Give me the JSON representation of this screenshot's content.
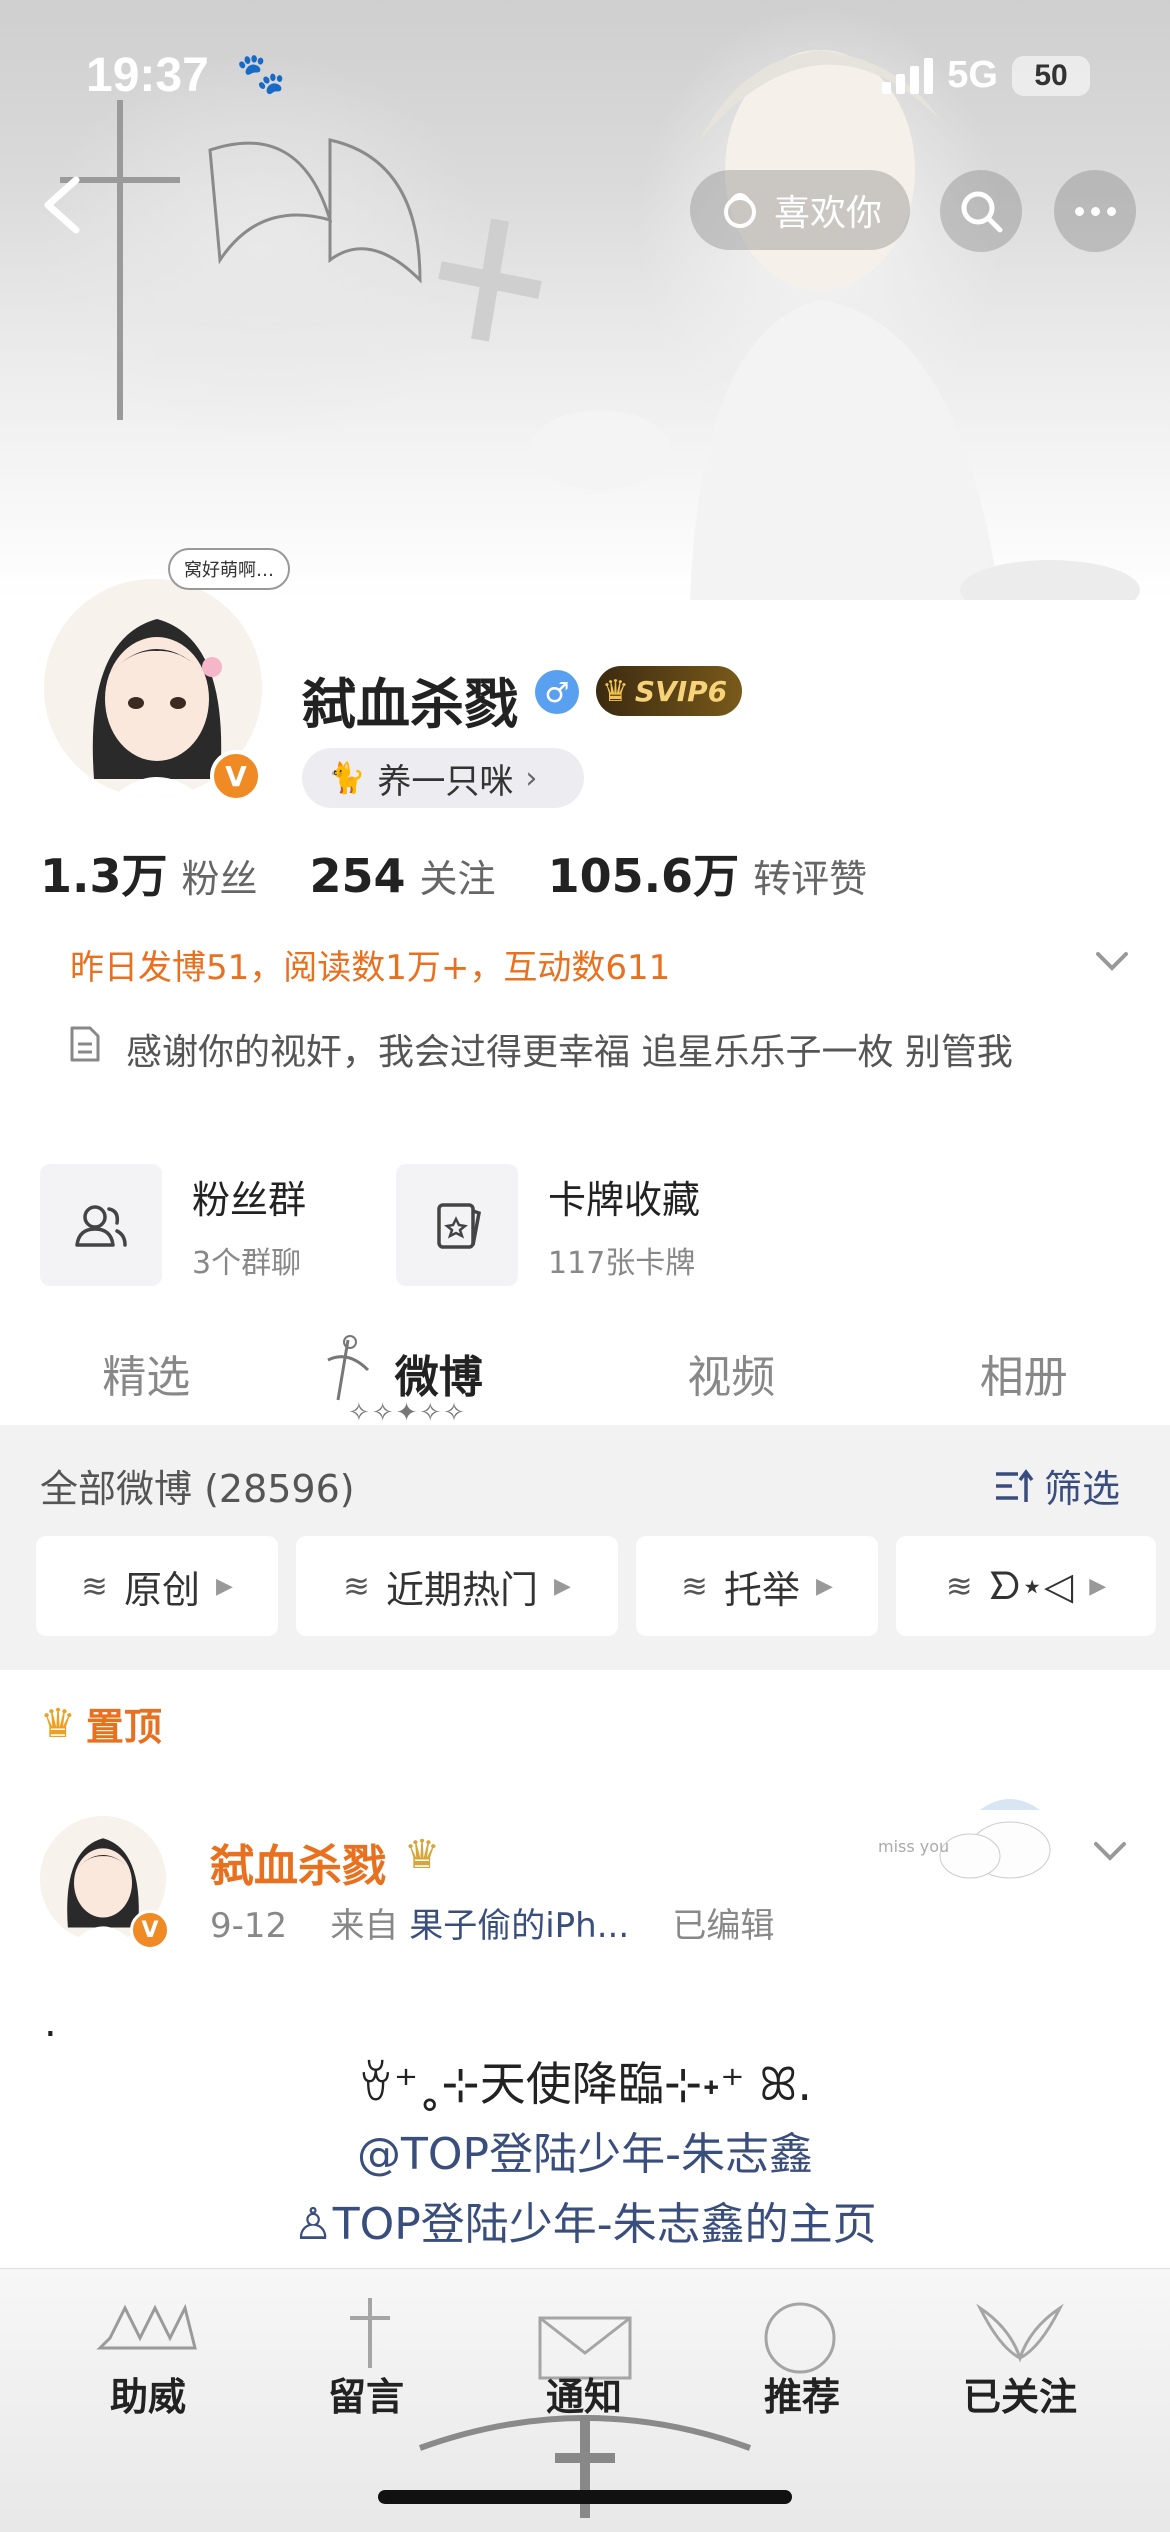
{
  "status_bar": {
    "time": "19:37",
    "network": "5G",
    "battery": "50"
  },
  "header": {
    "like_label": "喜欢你"
  },
  "profile": {
    "avatar_bubble": "窝好萌啊…",
    "name": "弑血杀戮",
    "svip_label": "SVIP6",
    "pet_label": "养一只咪",
    "stats": [
      {
        "value": "1.3万",
        "label": "粉丝"
      },
      {
        "value": "254",
        "label": "关注"
      },
      {
        "value": "105.6万",
        "label": "转评赞"
      }
    ],
    "activity": "昨日发博51，阅读数1万+，互动数611",
    "bio": "感谢你的视奸，我会过得更幸福  追星乐乐子一枚 别管我"
  },
  "cards": [
    {
      "title": "粉丝群",
      "sub": "3个群聊",
      "icon": "group-icon"
    },
    {
      "title": "卡牌收藏",
      "sub": "117张卡牌",
      "icon": "card-icon"
    }
  ],
  "tabs": [
    "精选",
    "微博",
    "视频",
    "相册"
  ],
  "tab_underline": "✧✧✦✧✧",
  "filter": {
    "all_posts": "全部微博 (28596)",
    "filter_label": "筛选",
    "chips": [
      "原创",
      "近期热门",
      "托举",
      "ᗤ⋆◁"
    ]
  },
  "pinned": {
    "label": "置顶",
    "name": "弑血杀戮",
    "date": "9-12",
    "from_prefix": "来自",
    "source": "果子偷的iPh...",
    "edited": "已编辑",
    "bubble": "窝好萌啊",
    "content": {
      "dot": ".",
      "line1": "ꈊ⁺˳⊹天使降臨⊹˖⁺ ꕤ.",
      "line2": "@TOP登陆少年-朱志鑫",
      "line3": "TOP登陆少年-朱志鑫的主页"
    }
  },
  "bottom_bar": [
    "助威",
    "留言",
    "通知",
    "推荐",
    "已关注"
  ],
  "colors": {
    "accent_orange": "#e8701e",
    "link_blue": "#3a4e7e",
    "vip_gold": "#f6d27a"
  }
}
